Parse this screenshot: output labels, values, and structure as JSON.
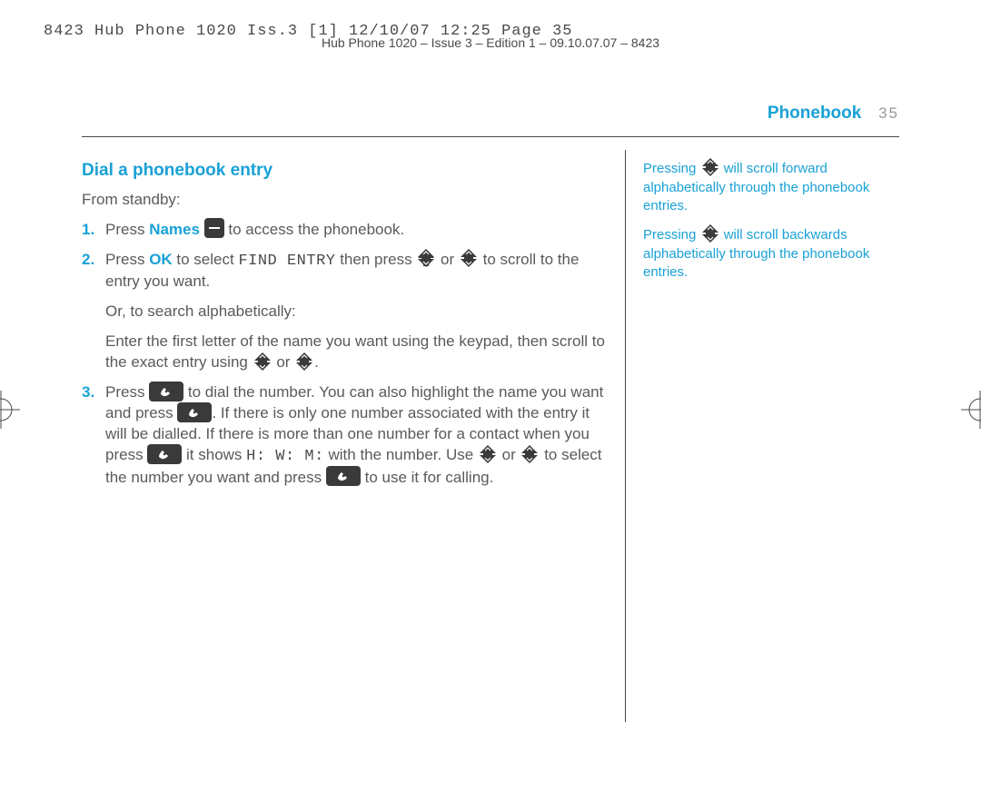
{
  "crop_top": "8423 Hub Phone 1020 Iss.3 [1]  12/10/07  12:25  Page 35",
  "crop_mid": "Hub Phone 1020 – Issue 3 – Edition 1 – 09.10.07.07 – 8423",
  "header": {
    "title": "Phonebook",
    "page_number": "35"
  },
  "main": {
    "heading": "Dial a phonebook entry",
    "from_standby": "From standby:",
    "step1": {
      "num": "1.",
      "a": "Press ",
      "names": "Names",
      "b": " to access the phonebook."
    },
    "step2": {
      "num": "2.",
      "a": "Press ",
      "ok": "OK",
      "b": " to select ",
      "find": "FIND ENTRY",
      "c": " then press ",
      "or": " or ",
      "d": " to scroll to the entry you want."
    },
    "or_search": "Or, to search alphabetically:",
    "search": {
      "a": "Enter the first letter of the name you want using the keypad, then scroll to the exact entry using ",
      "or": " or ",
      "b": "."
    },
    "step3": {
      "num": "3.",
      "a": "Press ",
      "b": " to dial the number. You can also highlight the name you want and press ",
      "c": ". If there is only one number associated with the entry it will be dialled. If there is more than one number for a contact when you press ",
      "d": " it shows ",
      "hwm": "H: W: M:",
      "e": " with the number. Use ",
      "or": " or ",
      "f": " to select the number you want and press ",
      "g": " to use it for calling."
    }
  },
  "side": {
    "p1a": "Pressing ",
    "p1b": " will scroll forward alphabetically through the phonebook entries.",
    "p2a": "Pressing ",
    "p2b": " will scroll backwards alphabetically through the phonebook entries."
  }
}
